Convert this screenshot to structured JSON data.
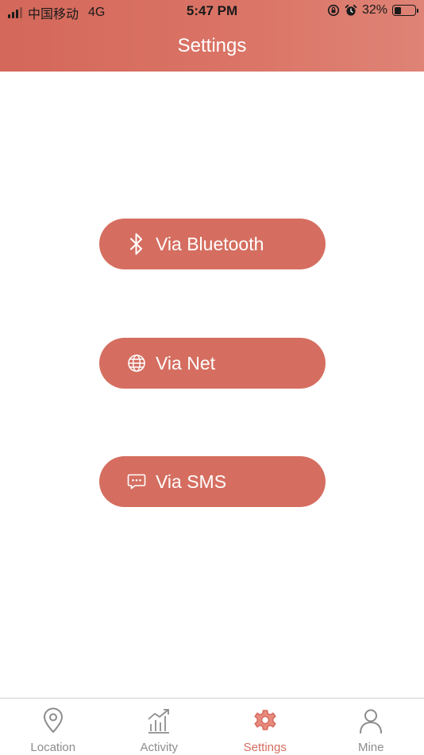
{
  "status_bar": {
    "carrier": "中国移动",
    "network": "4G",
    "time": "5:47 PM",
    "battery_percent_text": "32%",
    "battery_level": 0.32,
    "signal_bars": 3,
    "signal_total": 4
  },
  "header": {
    "title": "Settings"
  },
  "actions": [
    {
      "label": "Via Bluetooth",
      "icon": "bluetooth-icon"
    },
    {
      "label": "Via Net",
      "icon": "globe-icon"
    },
    {
      "label": "Via SMS",
      "icon": "message-icon"
    }
  ],
  "tabs": [
    {
      "label": "Location",
      "icon": "location-pin-icon",
      "active": false
    },
    {
      "label": "Activity",
      "icon": "activity-chart-icon",
      "active": false
    },
    {
      "label": "Settings",
      "icon": "gear-icon",
      "active": true
    },
    {
      "label": "Mine",
      "icon": "user-icon",
      "active": false
    }
  ],
  "colors": {
    "accent": "#d56e60",
    "header_start": "#d4685a",
    "header_end": "#de8376",
    "tab_inactive": "#8c8c8c",
    "background": "#ffffff"
  }
}
